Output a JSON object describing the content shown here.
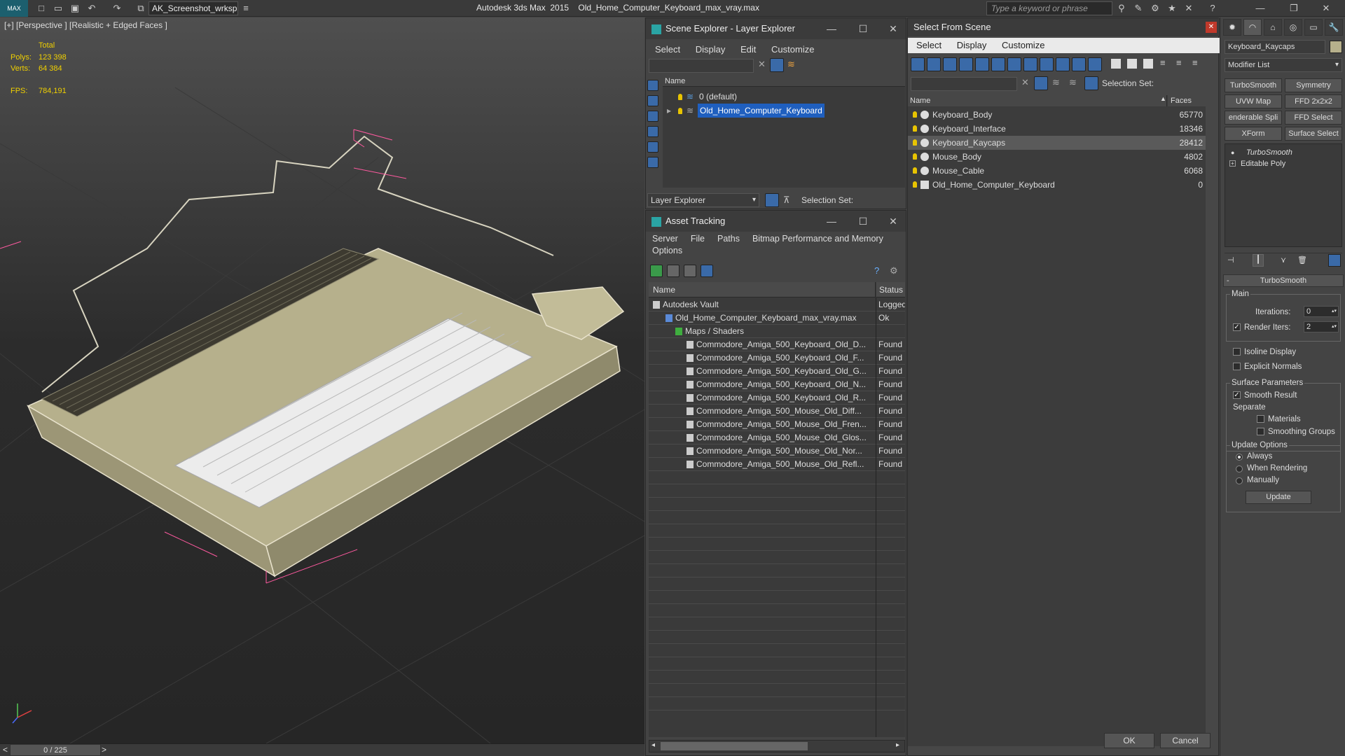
{
  "titlebar": {
    "workspace": "AK_Screenshot_wrksp",
    "app_title": "Autodesk 3ds Max  2015    Old_Home_Computer_Keyboard_max_vray.max",
    "search_placeholder": "Type a keyword or phrase"
  },
  "viewport": {
    "label": "[+] [Perspective ] [Realistic + Edged Faces ]",
    "stats": {
      "total_label": "Total",
      "polys_label": "Polys:",
      "polys_value": "123 398",
      "verts_label": "Verts:",
      "verts_value": "64 384",
      "fps_label": "FPS:",
      "fps_value": "784,191"
    },
    "timeline": {
      "position": "0 / 225",
      "prev": "<",
      "next": ">"
    }
  },
  "scene_explorer": {
    "title": "Scene Explorer - Layer Explorer",
    "menus": [
      "Select",
      "Display",
      "Edit",
      "Customize"
    ],
    "column_name": "Name",
    "layers": [
      {
        "name": "0 (default)"
      },
      {
        "name": "Old_Home_Computer_Keyboard"
      }
    ],
    "footer_dropdown": "Layer Explorer",
    "selection_set_label": "Selection Set:"
  },
  "asset_tracking": {
    "title": "Asset Tracking",
    "menus": [
      "Server",
      "File",
      "Paths",
      "Bitmap Performance and Memory",
      "Options"
    ],
    "columns": [
      "Name",
      "Status"
    ],
    "rows": [
      {
        "name": "Autodesk Vault",
        "status": "Logged"
      },
      {
        "name": "Old_Home_Computer_Keyboard_max_vray.max",
        "status": "Ok"
      },
      {
        "name": "Maps / Shaders",
        "status": ""
      },
      {
        "name": "Commodore_Amiga_500_Keyboard_Old_D...",
        "status": "Found"
      },
      {
        "name": "Commodore_Amiga_500_Keyboard_Old_F...",
        "status": "Found"
      },
      {
        "name": "Commodore_Amiga_500_Keyboard_Old_G...",
        "status": "Found"
      },
      {
        "name": "Commodore_Amiga_500_Keyboard_Old_N...",
        "status": "Found"
      },
      {
        "name": "Commodore_Amiga_500_Keyboard_Old_R...",
        "status": "Found"
      },
      {
        "name": "Commodore_Amiga_500_Mouse_Old_Diff...",
        "status": "Found"
      },
      {
        "name": "Commodore_Amiga_500_Mouse_Old_Fren...",
        "status": "Found"
      },
      {
        "name": "Commodore_Amiga_500_Mouse_Old_Glos...",
        "status": "Found"
      },
      {
        "name": "Commodore_Amiga_500_Mouse_Old_Nor...",
        "status": "Found"
      },
      {
        "name": "Commodore_Amiga_500_Mouse_Old_Refl...",
        "status": "Found"
      }
    ]
  },
  "select_from_scene": {
    "title": "Select From Scene",
    "menus": [
      "Select",
      "Display",
      "Customize"
    ],
    "selection_set_label": "Selection Set:",
    "columns": [
      "Name",
      "Faces"
    ],
    "objects": [
      {
        "name": "Keyboard_Body",
        "faces": "65770"
      },
      {
        "name": "Keyboard_Interface",
        "faces": "18346"
      },
      {
        "name": "Keyboard_Kaycaps",
        "faces": "28412"
      },
      {
        "name": "Mouse_Body",
        "faces": "4802"
      },
      {
        "name": "Mouse_Cable",
        "faces": "6068"
      },
      {
        "name": "Old_Home_Computer_Keyboard",
        "faces": "0"
      }
    ],
    "ok": "OK",
    "cancel": "Cancel"
  },
  "command_panel": {
    "object_name": "Keyboard_Kaycaps",
    "modifier_list": "Modifier List",
    "buttons": [
      "TurboSmooth",
      "Symmetry",
      "UVW Map",
      "FFD 2x2x2",
      "enderable Spli",
      "FFD Select",
      "XForm",
      "Surface Select"
    ],
    "stack": [
      "TurboSmooth",
      "Editable Poly"
    ],
    "turbosmooth": {
      "header": "TurboSmooth",
      "main": "Main",
      "iterations_label": "Iterations:",
      "iterations_value": "0",
      "render_iters_label": "Render Iters:",
      "render_iters_value": "2",
      "isoline": "Isoline Display",
      "explicit_normals": "Explicit Normals",
      "surface_params": "Surface Parameters",
      "smooth_result": "Smooth Result",
      "separate": "Separate",
      "materials": "Materials",
      "smoothing_groups": "Smoothing Groups",
      "update_options": "Update Options",
      "always": "Always",
      "when_rendering": "When Rendering",
      "manually": "Manually",
      "update_btn": "Update"
    }
  },
  "colors": {
    "selection_blue": "#1f5fbf",
    "viewport_wire": "#e8e2cc",
    "selection_wire": "#ff5aa0"
  }
}
